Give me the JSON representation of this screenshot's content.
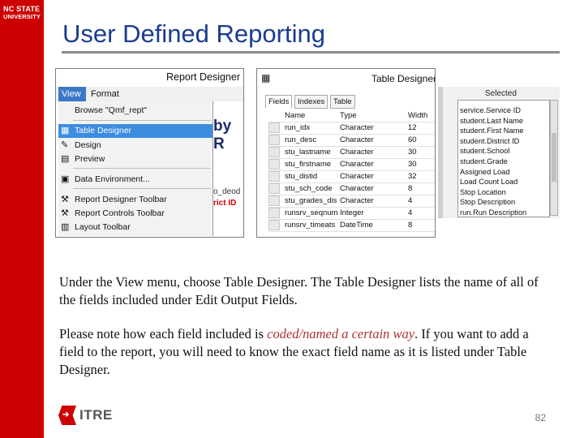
{
  "branding": {
    "line1": "NC STATE",
    "line2": "UNIVERSITY",
    "accent": "#cc0000",
    "footer_logo": "ITRE"
  },
  "slide": {
    "title": "User Defined Reporting",
    "page_number": "82"
  },
  "report_designer": {
    "window_title": "Report Designer",
    "menus": [
      "View",
      "Format"
    ],
    "menu_items": [
      {
        "label": "Browse \"Qmf_rept\"",
        "icon": "",
        "selected": false
      },
      {
        "label": "Table Designer",
        "icon": "table-icon",
        "selected": true
      },
      {
        "label": "Design",
        "icon": "design-icon",
        "selected": false
      },
      {
        "label": "Preview",
        "icon": "preview-icon",
        "selected": false
      },
      {
        "label": "Data Environment...",
        "icon": "database-icon",
        "selected": false
      },
      {
        "label": "Report Designer Toolbar",
        "icon": "tools-icon",
        "selected": false
      },
      {
        "label": "Report Controls Toolbar",
        "icon": "tools-icon",
        "selected": false
      },
      {
        "label": "Layout Toolbar",
        "icon": "layout-icon",
        "selected": false
      }
    ],
    "behind_text_1": "by R",
    "behind_text_2": "rict ID",
    "behind_text_3": "o_deod"
  },
  "table_designer": {
    "window_title": "Table Designer",
    "tabs": [
      "Fields",
      "Indexes",
      "Table"
    ],
    "columns": [
      "Name",
      "Type",
      "Width"
    ],
    "rows": [
      {
        "name": "run_idx",
        "type": "Character",
        "width": "12"
      },
      {
        "name": "run_desc",
        "type": "Character",
        "width": "60"
      },
      {
        "name": "stu_lastname",
        "type": "Character",
        "width": "30"
      },
      {
        "name": "stu_firstname",
        "type": "Character",
        "width": "30"
      },
      {
        "name": "stu_distid",
        "type": "Character",
        "width": "32"
      },
      {
        "name": "stu_sch_code",
        "type": "Character",
        "width": "8"
      },
      {
        "name": "stu_grades_dis",
        "type": "Character",
        "width": "4"
      },
      {
        "name": "runsrv_seqnum",
        "type": "Integer",
        "width": "4"
      },
      {
        "name": "runsrv_timeats",
        "type": "DateTime",
        "width": "8"
      }
    ]
  },
  "selected_fields": {
    "label": "Selected",
    "items": [
      "service.Service ID",
      "student.Last Name",
      "student.First Name",
      "student.District ID",
      "student.School",
      "student.Grade",
      "Assigned Load",
      "Load Count Load",
      "Stop Location",
      "Stop Description",
      "run.Run Description"
    ]
  },
  "body": {
    "para1": "Under the View menu, choose Table Designer. The Table Designer lists the name of all of the fields included under Edit Output Fields.",
    "para2_before": "Please note how each field included is ",
    "para2_highlight": "coded/named a certain way",
    "para2_after": ". If you want to add a field to the report, you will need to know the exact field name as it is listed under Table Designer."
  }
}
